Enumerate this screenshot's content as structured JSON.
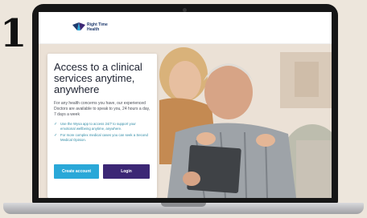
{
  "slide": {
    "number": "1"
  },
  "site": {
    "logo_line1": "Right Time",
    "logo_line2": "Health"
  },
  "hero": {
    "title": "Access to a clinical services anytime, anywhere",
    "body": "For any health concerns you have, our experienced Doctors are available to speak to you, 24 hours a day, 7 days a week",
    "bullets": [
      "Use the Wysa app to access 24/7 to support your emotional wellbeing anytime, anywhere.",
      "For more complex medical cases you can seek a Second Medical Opinion."
    ],
    "create_account_label": "Create account",
    "login_label": "Login"
  },
  "colors": {
    "primary_button": "#2aa8d8",
    "secondary_button": "#3c2775",
    "accent_text": "#2e8aa5",
    "brand_navy": "#1f3a6e"
  }
}
